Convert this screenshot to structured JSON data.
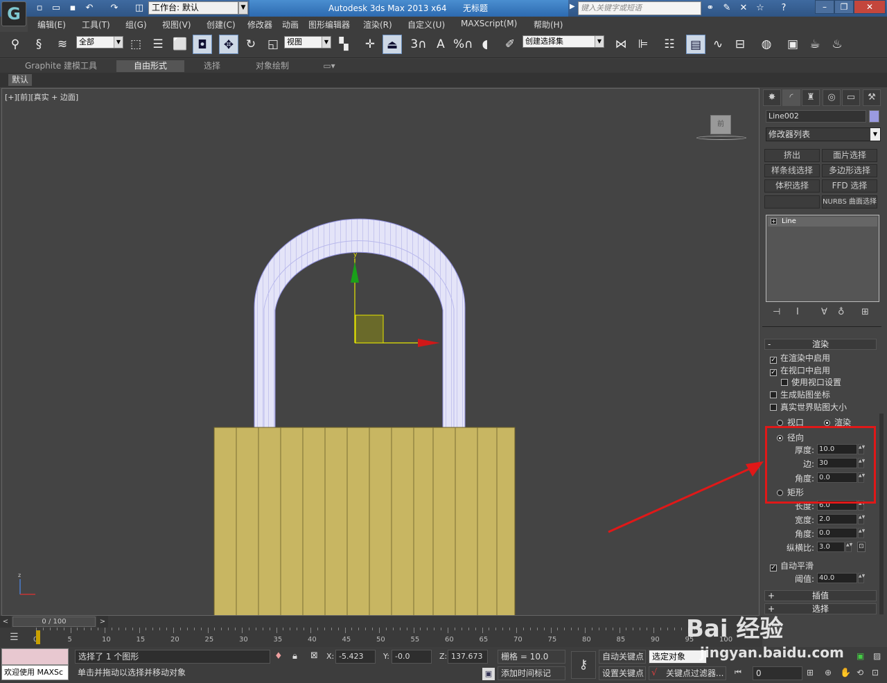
{
  "titlebar": {
    "workspace": "工作台: 默认",
    "app_name": "Autodesk 3ds Max  2013 x64",
    "doc_title": "无标题",
    "search_placeholder": "键入关键字或短语"
  },
  "menu": [
    "编辑(E)",
    "工具(T)",
    "组(G)",
    "视图(V)",
    "创建(C)",
    "修改器",
    "动画",
    "图形编辑器",
    "渲染(R)",
    "自定义(U)",
    "MAXScript(M)",
    "帮助(H)"
  ],
  "toolbar": {
    "filter_value": "全部",
    "coord_value": "视图",
    "selset_value": "创建选择集",
    "num3": "3",
    "angle_snap": "A",
    "percent": "%"
  },
  "ribbon": {
    "tabs": [
      "Graphite 建模工具",
      "自由形式",
      "选择",
      "对象绘制"
    ],
    "sub_label": "默认"
  },
  "viewport": {
    "label": "[+][前][真实 + 边面]",
    "cube_face": "前",
    "axis_z": "z",
    "axis_y": "y"
  },
  "cmdpanel": {
    "object_name": "Line002",
    "object_color": "#9a9ae0",
    "modifier_list": "修改器列表",
    "mod_buttons": [
      "挤出",
      "面片选择",
      "样条线选择",
      "多边形选择",
      "体积选择",
      "FFD 选择",
      "",
      "NURBS 曲面选择"
    ],
    "stack_item": "Line",
    "rollout_title": "渲染",
    "enable_render": "在渲染中启用",
    "enable_viewport": "在视口中启用",
    "use_viewport": "使用视口设置",
    "gen_map": "生成贴图坐标",
    "real_world": "真实世界贴图大小",
    "viewport_radio": "视口",
    "render_radio": "渲染",
    "radial": "径向",
    "thickness_label": "厚度:",
    "thickness": "10.0",
    "sides_label": "边:",
    "sides": "30",
    "angle_label": "角度:",
    "angle": "0.0",
    "rect": "矩形",
    "length_label": "长度:",
    "length": "6.0",
    "width_label": "宽度:",
    "width": "2.0",
    "angle2_label": "角度:",
    "angle2": "0.0",
    "aspect_label": "纵横比:",
    "aspect": "3.0",
    "autosmooth": "自动平滑",
    "threshold_label": "阈值:",
    "threshold": "40.0",
    "interp": "插值",
    "select": "选择"
  },
  "timeline": {
    "frame": "0 / 100",
    "ticks": [
      "0",
      "5",
      "10",
      "15",
      "20",
      "25",
      "30",
      "35",
      "40",
      "45",
      "50",
      "55",
      "60",
      "65",
      "70",
      "75",
      "80",
      "85",
      "90",
      "95",
      "100"
    ]
  },
  "status": {
    "welcome": "欢迎使用 MAXSc",
    "selected": "选择了 1 个图形",
    "hint": "单击并拖动以选择并移动对象",
    "x_label": "X:",
    "x": "-5.423",
    "y_label": "Y:",
    "y": "-0.0",
    "z_label": "Z:",
    "z": "137.673",
    "grid": "栅格 = 10.0",
    "auto_key": "自动关键点",
    "sel_obj": "选定对象",
    "set_key": "设置关键点",
    "key_filter": "关键点过滤器...",
    "add_time": "添加时间标记",
    "frame_field": "0"
  },
  "watermark": {
    "brand": "Bai 经验",
    "url": "jingyan.baidu.com"
  }
}
